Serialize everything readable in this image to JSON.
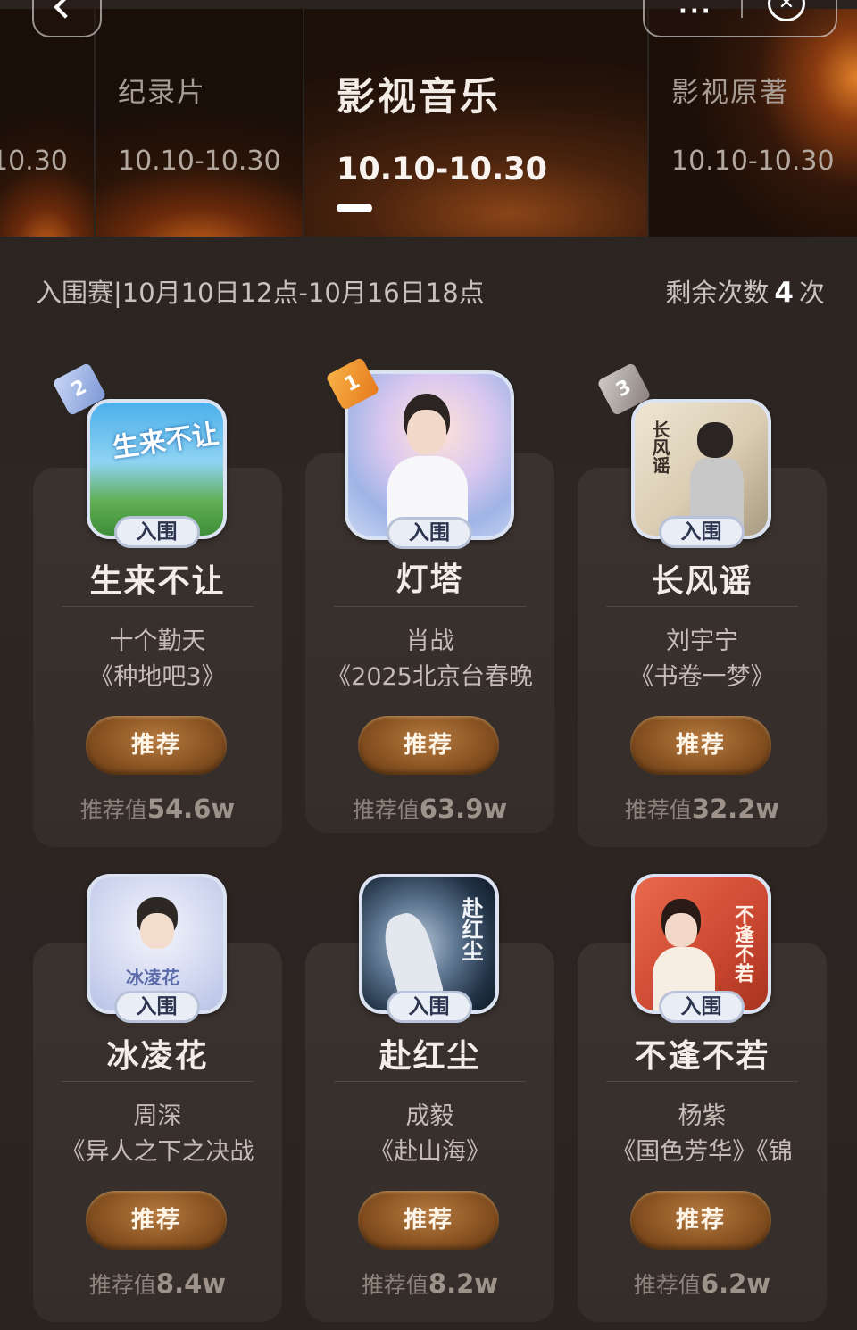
{
  "nav": {
    "close_glyph": "✕",
    "more_glyph": "···"
  },
  "tabs": [
    {
      "name": "",
      "date": "10.30"
    },
    {
      "name": "纪录片",
      "date": "10.10-10.30"
    },
    {
      "name": "影视音乐",
      "date": "10.10-10.30",
      "active": true
    },
    {
      "name": "影视原著",
      "date": "10.10-10.30"
    }
  ],
  "info": {
    "stage": "入围赛|10月10日12点-10月16日18点",
    "remaining_prefix": "剩余次数",
    "remaining_count": "4",
    "remaining_suffix": "次"
  },
  "cards": [
    {
      "rank": "2",
      "badge": "入围",
      "song": "生来不让",
      "artist": "十个勤天",
      "show": "《种地吧3》",
      "button": "推荐",
      "value_label": "推荐值",
      "value": "54.6w",
      "cover_text": "生来不让"
    },
    {
      "rank": "1",
      "badge": "入围",
      "song": "灯塔",
      "artist": "肖战",
      "show": "《2025北京台春晚",
      "button": "推荐",
      "value_label": "推荐值",
      "value": "63.9w",
      "cover_text": ""
    },
    {
      "rank": "3",
      "badge": "入围",
      "song": "长风谣",
      "artist": "刘宇宁",
      "show": "《书卷一梦》",
      "button": "推荐",
      "value_label": "推荐值",
      "value": "32.2w",
      "cover_text": "长风谣"
    },
    {
      "rank": "",
      "badge": "入围",
      "song": "冰凌花",
      "artist": "周深",
      "show": "《异人之下之决战",
      "button": "推荐",
      "value_label": "推荐值",
      "value": "8.4w",
      "cover_text": "冰凌花"
    },
    {
      "rank": "",
      "badge": "入围",
      "song": "赴红尘",
      "artist": "成毅",
      "show": "《赴山海》",
      "button": "推荐",
      "value_label": "推荐值",
      "value": "8.2w",
      "cover_text": "赴红尘"
    },
    {
      "rank": "",
      "badge": "入围",
      "song": "不逢不若",
      "artist": "杨紫",
      "show": "《国色芳华》《锦",
      "button": "推荐",
      "value_label": "推荐值",
      "value": "6.2w",
      "cover_text": "不逢不若"
    }
  ]
}
